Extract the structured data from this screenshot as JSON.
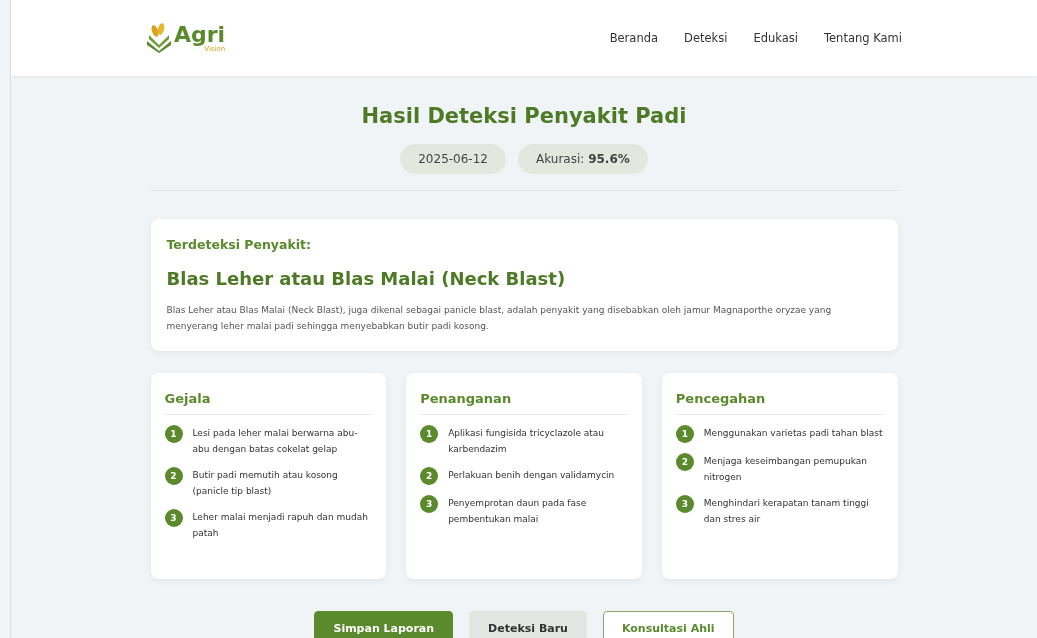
{
  "brand": {
    "name": "Agri",
    "tagline": "Vision"
  },
  "nav": [
    {
      "label": "Beranda"
    },
    {
      "label": "Deteksi"
    },
    {
      "label": "Edukasi"
    },
    {
      "label": "Tentang Kami"
    }
  ],
  "title": "Hasil Deteksi Penyakit Padi",
  "date": "2025-06-12",
  "accuracy": {
    "label": "Akurasi:",
    "value": "95.6%"
  },
  "detection": {
    "label": "Terdeteksi Penyakit:",
    "name": "Blas Leher atau Blas Malai (Neck Blast)",
    "description": "Blas Leher atau Blas Malai (Neck Blast), juga dikenal sebagai panicle blast, adalah penyakit yang disebabkan oleh jamur Magnaporthe oryzae yang menyerang leher malai padi sehingga menyebabkan butir padi kosong."
  },
  "sections": [
    {
      "title": "Gejala",
      "items": [
        {
          "number": "1",
          "text": "Lesi pada leher malai berwarna abu-abu dengan batas cokelat gelap"
        },
        {
          "number": "2",
          "text": "Butir padi memutih atau kosong (panicle tip blast)"
        },
        {
          "number": "3",
          "text": "Leher malai menjadi rapuh dan mudah patah"
        }
      ]
    },
    {
      "title": "Penanganan",
      "items": [
        {
          "number": "1",
          "text": "Aplikasi fungisida tricyclazole atau karbendazim"
        },
        {
          "number": "2",
          "text": "Perlakuan benih dengan validamycin"
        },
        {
          "number": "3",
          "text": "Penyemprotan daun pada fase pembentukan malai"
        }
      ]
    },
    {
      "title": "Pencegahan",
      "items": [
        {
          "number": "1",
          "text": "Menggunakan varietas padi tahan blast"
        },
        {
          "number": "2",
          "text": "Menjaga keseimbangan pemupukan nitrogen"
        },
        {
          "number": "3",
          "text": "Menghindari kerapatan tanam tinggi dan stres air"
        }
      ]
    }
  ],
  "buttons": [
    {
      "label": "Simpan Laporan",
      "kind": "primary"
    },
    {
      "label": "Deteksi Baru",
      "kind": "secondary"
    },
    {
      "label": "Konsultasi Ahli",
      "kind": "outline"
    }
  ]
}
